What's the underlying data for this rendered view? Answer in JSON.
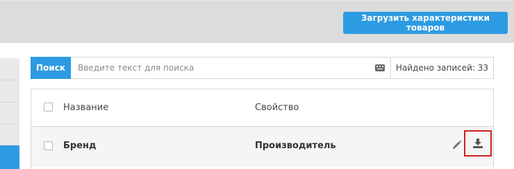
{
  "toolbar": {
    "upload_label": "Загрузить характеристики товаров"
  },
  "search": {
    "button_label": "Поиск",
    "placeholder": "Введите текст для поиска",
    "found_label": "Найдено записей: 33"
  },
  "table": {
    "columns": [
      "Название",
      "Свойство"
    ],
    "rows": [
      {
        "name": "Бренд",
        "property": "Производитель"
      }
    ]
  },
  "icons": {
    "keyboard": "keyboard-icon",
    "edit": "pencil-icon",
    "download": "download-icon"
  },
  "colors": {
    "accent": "#2d9be2",
    "highlight": "#cc1f1f"
  }
}
